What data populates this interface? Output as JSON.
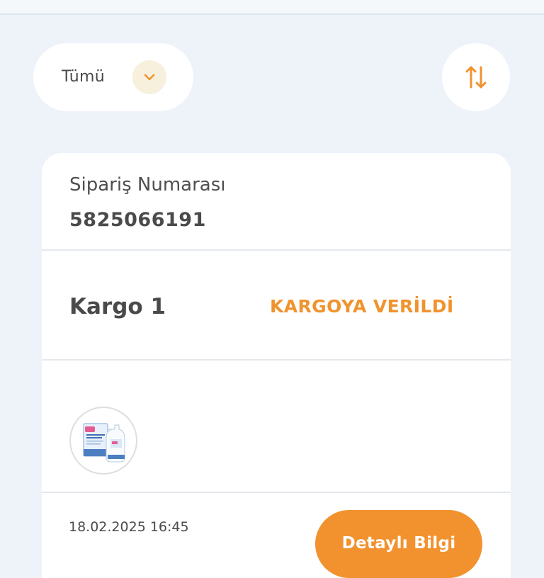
{
  "filter": {
    "selected": "Tümü",
    "icon": "chevron-down-icon"
  },
  "sort": {
    "icon": "sort-arrows-icon"
  },
  "order": {
    "number_label": "Sipariş Numarası",
    "number_value": "5825066191",
    "cargo_title": "Kargo 1",
    "cargo_status": "KARGOYA VERİLDİ",
    "product_icon": "product-thumbnail",
    "date": "18.02.2025 16:45",
    "detail_button_label": "Detaylı Bilgi"
  },
  "colors": {
    "background": "#edf3f9",
    "accent": "#f2922f",
    "status": "#f0932e",
    "text": "#4a4a4a"
  }
}
